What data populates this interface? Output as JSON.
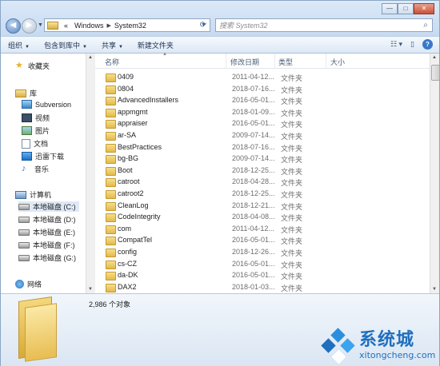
{
  "window": {
    "controls": {
      "minimize": "—",
      "maximize": "□",
      "close": "✕"
    }
  },
  "address": {
    "overflow": "«",
    "crumbs": [
      "Windows",
      "System32"
    ],
    "search_placeholder": "搜索 System32"
  },
  "toolbar": {
    "organize": "组织",
    "include_library": "包含到库中",
    "share": "共享",
    "new_folder": "新建文件夹"
  },
  "nav": {
    "favorites": "收藏夹",
    "libraries": "库",
    "lib_items": [
      "Subversion",
      "视频",
      "图片",
      "文档",
      "迅雷下载",
      "音乐"
    ],
    "computer": "计算机",
    "drives": [
      "本地磁盘 (C:)",
      "本地磁盘 (D:)",
      "本地磁盘 (E:)",
      "本地磁盘 (F:)",
      "本地磁盘 (G:)"
    ],
    "network": "网络"
  },
  "columns": {
    "name": "名称",
    "date": "修改日期",
    "type": "类型",
    "size": "大小"
  },
  "files": [
    {
      "name": "0409",
      "date": "2011-04-12...",
      "type": "文件夹"
    },
    {
      "name": "0804",
      "date": "2018-07-16...",
      "type": "文件夹"
    },
    {
      "name": "AdvancedInstallers",
      "date": "2016-05-01...",
      "type": "文件夹"
    },
    {
      "name": "appmgmt",
      "date": "2018-01-09...",
      "type": "文件夹"
    },
    {
      "name": "appraiser",
      "date": "2016-05-01...",
      "type": "文件夹"
    },
    {
      "name": "ar-SA",
      "date": "2009-07-14...",
      "type": "文件夹"
    },
    {
      "name": "BestPractices",
      "date": "2018-07-16...",
      "type": "文件夹"
    },
    {
      "name": "bg-BG",
      "date": "2009-07-14...",
      "type": "文件夹"
    },
    {
      "name": "Boot",
      "date": "2018-12-25...",
      "type": "文件夹"
    },
    {
      "name": "catroot",
      "date": "2018-04-28...",
      "type": "文件夹"
    },
    {
      "name": "catroot2",
      "date": "2018-12-25...",
      "type": "文件夹"
    },
    {
      "name": "CleanLog",
      "date": "2018-12-21...",
      "type": "文件夹"
    },
    {
      "name": "CodeIntegrity",
      "date": "2018-04-08...",
      "type": "文件夹"
    },
    {
      "name": "com",
      "date": "2011-04-12...",
      "type": "文件夹"
    },
    {
      "name": "CompatTel",
      "date": "2016-05-01...",
      "type": "文件夹"
    },
    {
      "name": "config",
      "date": "2018-12-26...",
      "type": "文件夹"
    },
    {
      "name": "cs-CZ",
      "date": "2016-05-01...",
      "type": "文件夹"
    },
    {
      "name": "da-DK",
      "date": "2016-05-01...",
      "type": "文件夹"
    },
    {
      "name": "DAX2",
      "date": "2018-01-03...",
      "type": "文件夹"
    }
  ],
  "status": {
    "count": "2,986 个对象"
  },
  "watermark": {
    "brand": "系统城",
    "url": "xitongcheng.com"
  }
}
